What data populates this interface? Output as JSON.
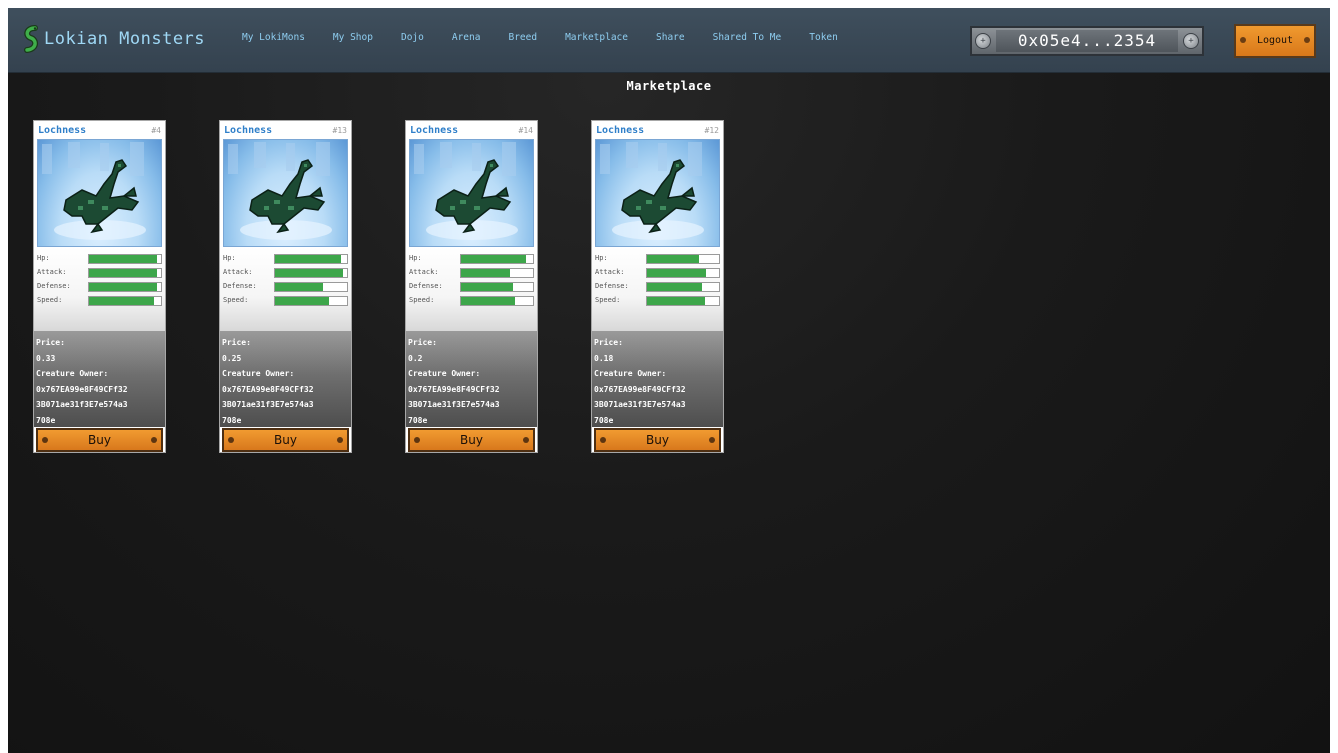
{
  "brand": {
    "name": "Lokian Monsters",
    "logo_icon": "serpent-icon"
  },
  "nav": {
    "links": [
      {
        "label": "My LokiMons"
      },
      {
        "label": "My Shop"
      },
      {
        "label": "Dojo"
      },
      {
        "label": "Arena"
      },
      {
        "label": "Breed"
      },
      {
        "label": "Marketplace"
      },
      {
        "label": "Share"
      },
      {
        "label": "Shared To Me"
      },
      {
        "label": "Token"
      }
    ]
  },
  "wallet": {
    "address": "0x05e4...2354"
  },
  "logout": {
    "label": "Logout"
  },
  "page": {
    "title": "Marketplace"
  },
  "stat_labels": [
    "Hp:",
    "Attack:",
    "Defense:",
    "Speed:"
  ],
  "labels": {
    "price": "Price:",
    "owner": "Creature Owner:",
    "buy": "Buy"
  },
  "colors": {
    "accent": "#e98a26",
    "nav_bg": "#3b4a57",
    "stat_bar": "#3da64a",
    "link": "#8ecdf0"
  },
  "cards": [
    {
      "name": "Lochness",
      "id": "#4",
      "stats": {
        "hp": 0.95,
        "attack": 0.95,
        "defense": 0.95,
        "speed": 0.9
      },
      "price": "0.33",
      "owner_lines": [
        "0x767EA99e8F49CFf32",
        "3B071ae31f3E7e574a3",
        "708e"
      ]
    },
    {
      "name": "Lochness",
      "id": "#13",
      "stats": {
        "hp": 0.92,
        "attack": 0.94,
        "defense": 0.66,
        "speed": 0.75
      },
      "price": "0.25",
      "owner_lines": [
        "0x767EA99e8F49CFf32",
        "3B071ae31f3E7e574a3",
        "708e"
      ]
    },
    {
      "name": "Lochness",
      "id": "#14",
      "stats": {
        "hp": 0.9,
        "attack": 0.68,
        "defense": 0.72,
        "speed": 0.75
      },
      "price": "0.2",
      "owner_lines": [
        "0x767EA99e8F49CFf32",
        "3B071ae31f3E7e574a3",
        "708e"
      ]
    },
    {
      "name": "Lochness",
      "id": "#12",
      "stats": {
        "hp": 0.72,
        "attack": 0.82,
        "defense": 0.76,
        "speed": 0.8
      },
      "price": "0.18",
      "owner_lines": [
        "0x767EA99e8F49CFf32",
        "3B071ae31f3E7e574a3",
        "708e"
      ]
    }
  ]
}
